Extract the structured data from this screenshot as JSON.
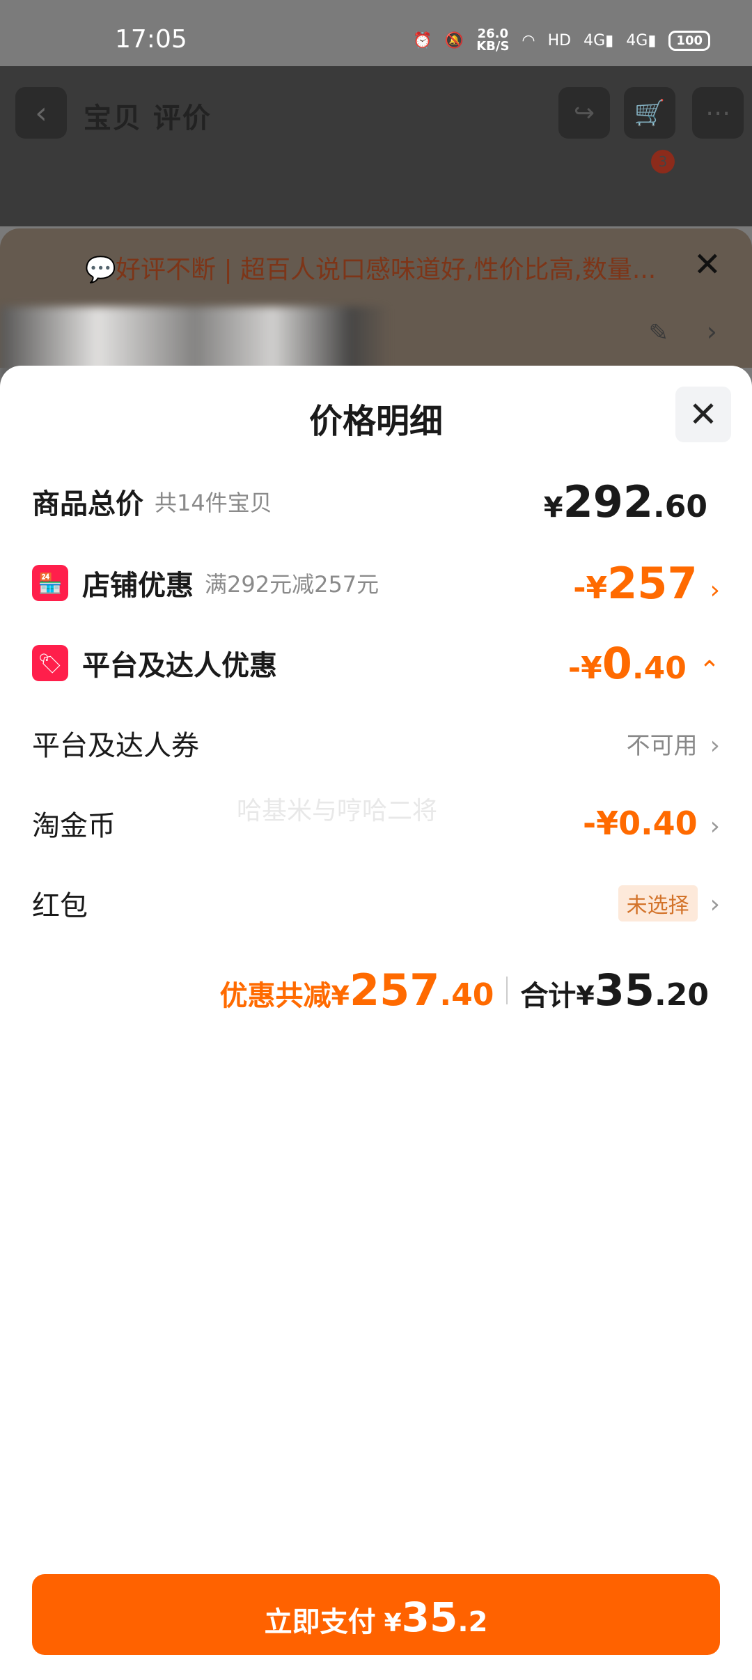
{
  "status_bar": {
    "time": "17:05",
    "net_speed": "26.0",
    "net_unit": "KB/S",
    "hd": "HD",
    "sig1": "4G",
    "sig2": "4G",
    "battery": "100"
  },
  "background_page": {
    "title": "宝贝 评价",
    "cart_badge": "3"
  },
  "banner": {
    "text": "好评不断 | 超百人说口感味道好,性价比高,数量..."
  },
  "sheet": {
    "title": "价格明细",
    "total": {
      "label": "商品总价",
      "sub": "共14件宝贝",
      "symbol": "¥",
      "int": "292",
      "dec": ".60"
    },
    "shop_discount": {
      "label": "店铺优惠",
      "sub": "满292元减257元",
      "prefix": "-¥",
      "int": "257"
    },
    "platform_discount": {
      "label": "平台及达人优惠",
      "prefix": "-¥",
      "int": "0",
      "dec": ".40"
    },
    "coupon": {
      "label": "平台及达人券",
      "value": "不可用"
    },
    "coins": {
      "label": "淘金币",
      "value": "-¥0.40"
    },
    "red_packet": {
      "label": "红包",
      "value": "未选择"
    },
    "watermark": "哈基米与哼哈二将",
    "summary": {
      "discount_label": "优惠共减",
      "discount_symbol": "¥",
      "discount_int": "257",
      "discount_dec": ".40",
      "total_label": "合计",
      "total_symbol": "¥",
      "total_int": "35",
      "total_dec": ".20"
    },
    "pay_button": {
      "label": "立即支付",
      "symbol": "¥",
      "int": "35",
      "dec": ".2"
    }
  }
}
